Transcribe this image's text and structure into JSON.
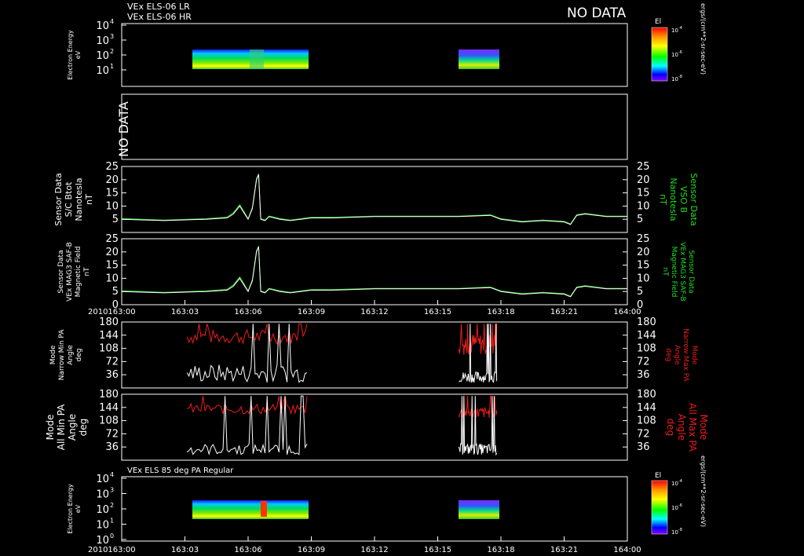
{
  "colors": {
    "background": "#000000",
    "axes": "#ffffff",
    "b_total": "#ffffff",
    "b_vso": "#22dd22",
    "min_pa": "#ffffff",
    "max_pa": "#ee1c1c"
  },
  "header": {
    "line1": "VEx ELS-06 LR",
    "line2": "VEx ELS-06 HR",
    "no_data": "NO DATA"
  },
  "x_axis": {
    "year": "2010",
    "ticks": [
      "163:00",
      "163:03",
      "163:06",
      "163:09",
      "163:12",
      "163:15",
      "163:18",
      "163:21",
      "164:00"
    ]
  },
  "spectrogram_top": {
    "ylabel": [
      "Electron Energy",
      "eV"
    ],
    "yticks": [
      "10",
      "10",
      "10",
      "10"
    ],
    "yticks_exp": [
      "4",
      "3",
      "2",
      "1"
    ],
    "colorbar": {
      "title": "El",
      "ticks": [
        "10",
        "10",
        "10"
      ],
      "ticks_exp": [
        "-4",
        "-6",
        "-8"
      ],
      "unit": "ergs/(cm**2-sr-sec-eV)"
    }
  },
  "panel_nodata": {
    "label": "NO DATA"
  },
  "panel_b1": {
    "left_label": [
      "Sensor Data",
      "S/C Btot",
      "Nanotesla",
      "nT"
    ],
    "right_label": [
      "Sensor Data",
      "VSO B",
      "Nanotesla",
      "nT"
    ],
    "yticks": [
      "25",
      "20",
      "15",
      "10",
      "5"
    ]
  },
  "panel_b2": {
    "left_label": [
      "Sensor Data",
      "VEx MAG3 SAF-B",
      "Magnetic Field",
      "nT"
    ],
    "right_label": [
      "Sensor Data",
      "VEx MAG3 SAF-B",
      "Magnetic Field",
      "nT"
    ],
    "yticks": [
      "25",
      "20",
      "15",
      "10",
      "5",
      "0"
    ]
  },
  "panel_pa1": {
    "left_label": [
      "Mode",
      "Narrow Min PA",
      "Angle",
      "deg"
    ],
    "right_label": [
      "Mode",
      "Narrow Max PA",
      "Angle",
      "deg"
    ],
    "yticks": [
      "180",
      "144",
      "108",
      "72",
      "36"
    ]
  },
  "panel_pa2": {
    "left_label": [
      "Mode",
      "All Min PA",
      "Angle",
      "deg"
    ],
    "right_label": [
      "Mode",
      "All Max PA",
      "Angle",
      "deg"
    ],
    "yticks": [
      "180",
      "144",
      "108",
      "72",
      "36"
    ]
  },
  "spectrogram_bottom": {
    "title": "VEx ELS 85 deg PA Regular",
    "ylabel": [
      "Electron Energy",
      "eV"
    ],
    "yticks": [
      "10",
      "10",
      "10",
      "10",
      "10"
    ],
    "yticks_exp": [
      "4",
      "3",
      "2",
      "1",
      "0"
    ],
    "colorbar": {
      "title": "El",
      "ticks": [
        "10",
        "10",
        "10"
      ],
      "ticks_exp": [
        "-4",
        "-6",
        "-8"
      ],
      "unit": "ergs/(cm**2-sr-sec-eV)"
    }
  },
  "chart_data": [
    {
      "type": "heatmap",
      "title": "VEx ELS-06 LR / HR",
      "ylabel": "Electron Energy eV",
      "y_scale": "log",
      "ylim": [
        1,
        10000
      ],
      "data_intervals": [
        {
          "start": 3.1,
          "end": 8.8,
          "emin": 10,
          "emax": 200
        },
        {
          "start": 16.0,
          "end": 17.8,
          "emin": 10,
          "emax": 200
        }
      ]
    },
    {
      "type": "line",
      "title": "",
      "ylabel": "Sensor Data S/C Btot Nanotesla nT",
      "ylim": [
        0,
        25
      ],
      "x_unit": "minutes after 163:00 (x3 per tick)",
      "series": [
        {
          "name": "S/C Btot",
          "x": [
            0,
            2,
            4,
            5,
            5.3,
            5.6,
            5.8,
            6.0,
            6.2,
            6.4,
            6.5,
            6.6,
            6.8,
            7.0,
            7.5,
            8,
            9,
            10,
            12,
            14,
            16,
            17.5,
            18,
            19,
            20,
            21,
            21.3,
            21.6,
            22,
            23,
            24
          ],
          "y": [
            5,
            4.5,
            5,
            5.5,
            7,
            10,
            7.5,
            5,
            9,
            20,
            22,
            5,
            4.5,
            6,
            5,
            4.5,
            5.5,
            5.5,
            6,
            6,
            6,
            6.5,
            5,
            4,
            4.5,
            4,
            3,
            6.5,
            7,
            6,
            6
          ]
        },
        {
          "name": "VSO B",
          "x": [
            0,
            2,
            4,
            5,
            5.3,
            5.6,
            5.8,
            6.0,
            6.2,
            6.4,
            6.5,
            6.6,
            6.8,
            7.0,
            7.5,
            8,
            9,
            10,
            12,
            14,
            16,
            17.5,
            18,
            19,
            20,
            21,
            21.3,
            21.6,
            22,
            23,
            24
          ],
          "y": [
            5.3,
            4.7,
            5.2,
            5.8,
            7.5,
            10.5,
            8,
            5.2,
            9.5,
            20.5,
            22,
            5.2,
            4.7,
            6.2,
            5.3,
            4.7,
            5.7,
            5.7,
            6.2,
            6.2,
            6.2,
            6.7,
            5.2,
            4.2,
            4.7,
            4.2,
            3.2,
            6.7,
            7.2,
            6.2,
            6.2
          ]
        }
      ]
    },
    {
      "type": "line",
      "ylabel": "Mode Narrow Min/Max PA Angle deg",
      "ylim": [
        0,
        180
      ],
      "series": [
        {
          "name": "Narrow Min PA",
          "segments": [
            [
              3.1,
              8.8
            ],
            [
              16.0,
              17.8
            ]
          ]
        },
        {
          "name": "Narrow Max PA",
          "segments": [
            [
              3.1,
              8.8
            ],
            [
              16.0,
              17.8
            ]
          ]
        }
      ]
    },
    {
      "type": "line",
      "ylabel": "Mode All Min/Max PA Angle deg",
      "ylim": [
        0,
        180
      ],
      "series": [
        {
          "name": "All Min PA",
          "segments": [
            [
              3.1,
              8.8
            ],
            [
              16.0,
              17.8
            ]
          ]
        },
        {
          "name": "All Max PA",
          "segments": [
            [
              3.1,
              8.8
            ],
            [
              16.0,
              17.8
            ]
          ]
        }
      ]
    },
    {
      "type": "heatmap",
      "title": "VEx ELS 85 deg PA Regular",
      "ylabel": "Electron Energy eV",
      "y_scale": "log",
      "ylim": [
        1,
        10000
      ],
      "data_intervals": [
        {
          "start": 3.1,
          "end": 8.8,
          "emin": 10,
          "emax": 200
        },
        {
          "start": 16.0,
          "end": 17.8,
          "emin": 10,
          "emax": 200
        }
      ]
    }
  ]
}
